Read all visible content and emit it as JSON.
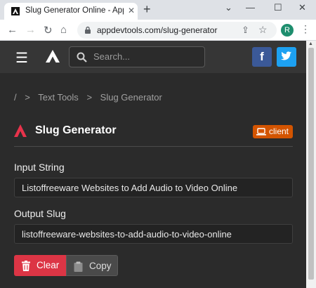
{
  "browser": {
    "tab_title": "Slug Generator Online - AppDev",
    "url": "appdevtools.com/slug-generator",
    "profile_initial": "R"
  },
  "header": {
    "search_placeholder": "Search...",
    "facebook_glyph": "f"
  },
  "breadcrumb": {
    "root": "/",
    "separator": ">",
    "items": [
      "Text Tools",
      "Slug Generator"
    ]
  },
  "page": {
    "title": "Slug Generator",
    "badge_label": "client"
  },
  "form": {
    "input_label": "Input String",
    "input_value": "Listoffreeware Websites to Add Audio to Video Online",
    "output_label": "Output Slug",
    "output_value": "listoffreeware-websites-to-add-audio-to-video-online"
  },
  "actions": {
    "clear_label": "Clear",
    "copy_label": "Copy"
  },
  "colors": {
    "accent": "#dc3545",
    "badge": "#d35400",
    "facebook": "#3b5998",
    "twitter": "#1da1f2"
  }
}
